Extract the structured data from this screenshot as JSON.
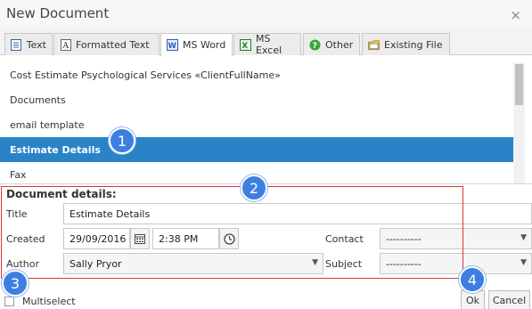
{
  "window": {
    "title": "New Document",
    "close_glyph": "×"
  },
  "tabs": [
    {
      "label": "Text",
      "icon": "text-doc-icon"
    },
    {
      "label": "Formatted Text",
      "icon": "formatted-text-icon"
    },
    {
      "label": "MS Word",
      "icon": "word-icon",
      "active": true
    },
    {
      "label": "MS Excel",
      "icon": "excel-icon"
    },
    {
      "label": "Other",
      "icon": "help-icon"
    },
    {
      "label": "Existing File",
      "icon": "folder-icon"
    }
  ],
  "templates": [
    {
      "label": "Cost Estimate Psychological Services «ClientFullName»"
    },
    {
      "label": "Documents"
    },
    {
      "label": "email template"
    },
    {
      "label": "Estimate Details",
      "selected": true
    },
    {
      "label": "Fax"
    }
  ],
  "details": {
    "heading": "Document details:",
    "title_label": "Title",
    "title_value": "Estimate Details",
    "created_label": "Created",
    "created_date": "29/09/2016",
    "created_time": "2:38 PM",
    "author_label": "Author",
    "author_value": "Sally Pryor",
    "contact_label": "Contact",
    "contact_value": "----------",
    "subject_label": "Subject",
    "subject_value": "----------"
  },
  "annotations": [
    "1",
    "2",
    "3",
    "4"
  ],
  "footer": {
    "multiselect_label": "Multiselect",
    "ok_label": "Ok",
    "cancel_label": "Cancel"
  },
  "colors": {
    "selected_row": "#2b83c7",
    "annotation_badge": "#3d7fe0",
    "highlight_box": "#d9373a"
  }
}
